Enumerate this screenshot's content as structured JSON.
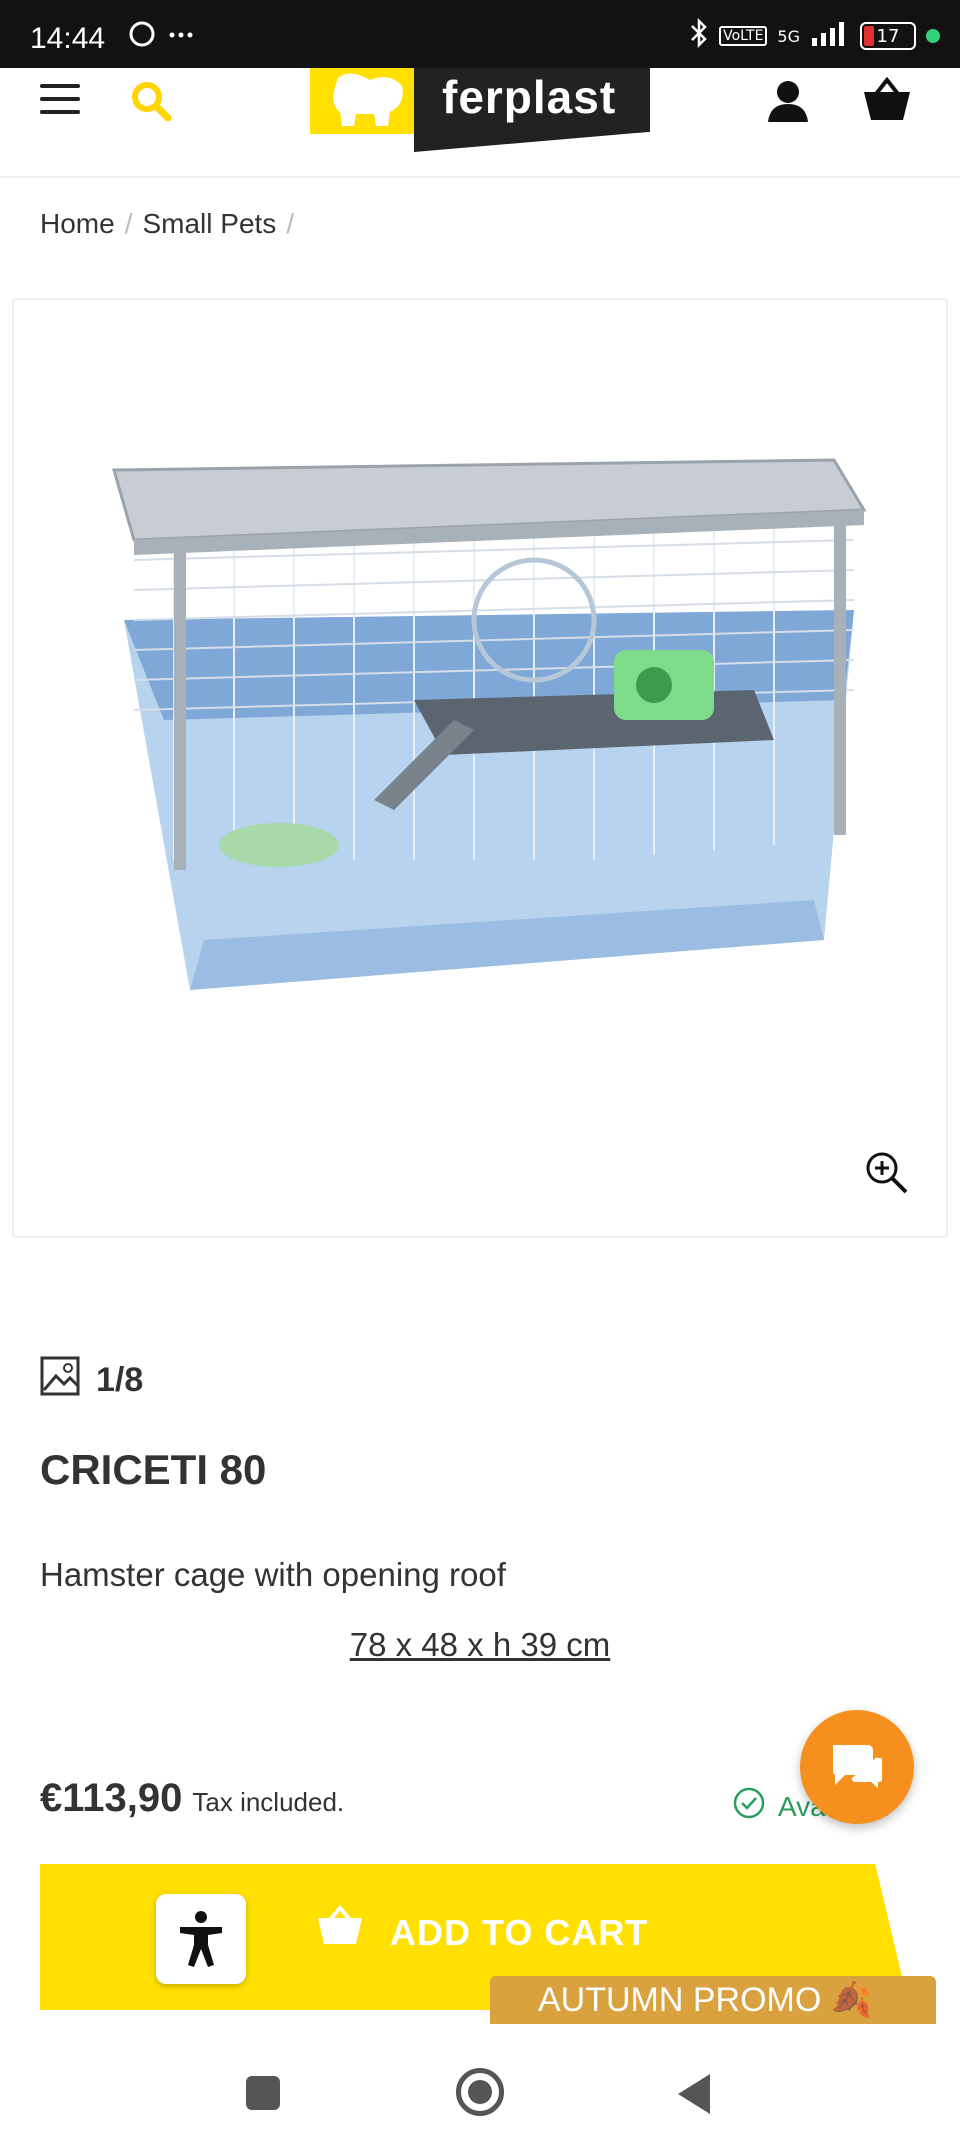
{
  "status_bar": {
    "time": "14:44",
    "battery": "17",
    "network": "5G"
  },
  "header": {
    "brand": "ferplast"
  },
  "breadcrumb": {
    "items": [
      "Home",
      "Small Pets"
    ]
  },
  "gallery": {
    "counter": "1/8"
  },
  "product": {
    "name": "CRICETI 80",
    "description": "Hamster cage with opening roof",
    "dimensions": "78 x 48 x h 39 cm",
    "price": "€113,90",
    "tax_note": "Tax included.",
    "availability": "Available"
  },
  "cart": {
    "label": "ADD TO CART"
  },
  "promo": {
    "label": "AUTUMN PROMO 🍂"
  },
  "colors": {
    "brand_yellow": "#ffe000",
    "chat_orange": "#f5901e",
    "promo_gold": "#d9a23e",
    "available_green": "#2a9d5a"
  }
}
